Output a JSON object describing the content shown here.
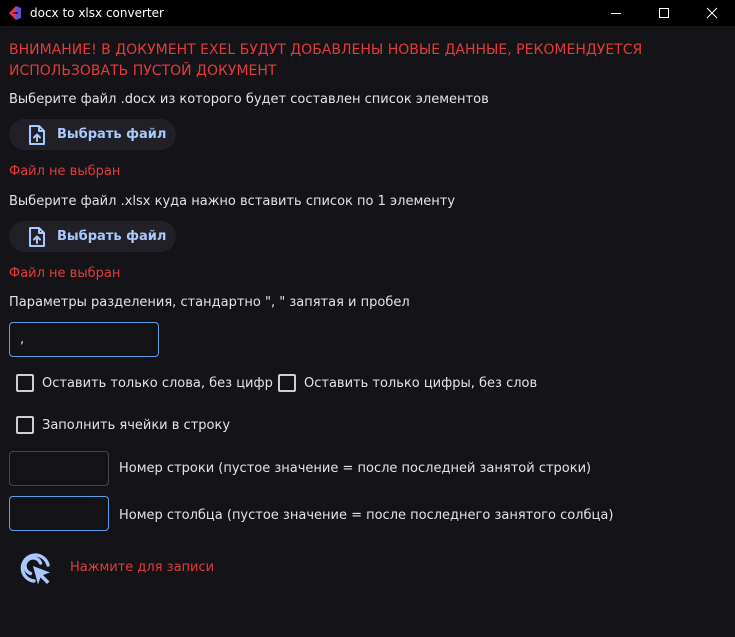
{
  "window": {
    "title": "docx to xlsx converter",
    "icon": "flet-app-icon",
    "controls": {
      "minimize_icon": "minimize-icon",
      "maximize_icon": "maximize-icon",
      "close_icon": "close-icon"
    }
  },
  "warning": "ВНИМАНИЕ! В ДОКУМЕНТ EXEL БУДУТ ДОБАВЛЕНЫ НОВЫЕ ДАННЫЕ, РЕКОМЕНДУЕТСЯ ИСПОЛЬЗОВАТЬ ПУСТОЙ ДОКУМЕНТ",
  "docx_section": {
    "label": "Выберите файл .docx из которого будет составлен список элементов",
    "button_label": "Выбрать файл",
    "button_icon": "file-upload-icon",
    "status": "Файл не выбран"
  },
  "xlsx_section": {
    "label": "Выберите файл .xlsx куда нажно вставить список по 1 элементу",
    "button_label": "Выбрать файл",
    "button_icon": "file-upload-icon",
    "status": "Файл не выбран"
  },
  "separator": {
    "label": "Параметры разделения, стандартно \", \" запятая и пробел",
    "value": ", "
  },
  "options": {
    "words_only": {
      "label": "Оставить только слова, без цифр",
      "checked": false
    },
    "digits_only": {
      "label": "Оставить только цифры, без слов",
      "checked": false
    },
    "fill_row": {
      "label": "Заполнить ячейки в строку",
      "checked": false
    }
  },
  "row_number": {
    "value": "",
    "label": "Номер строки (пустое значение = после последней занятой строки)"
  },
  "column_number": {
    "value": "",
    "label": "Номер столбца (пустое значение = после последнего занятого солбца)"
  },
  "record": {
    "icon": "ads-click-icon",
    "label": "Нажмите для записи"
  },
  "colors": {
    "background": "#141318",
    "warning": "#e33b3b",
    "accent": "#a9c8fb",
    "button_background": "#212026",
    "focus_border": "#5b9fe8"
  }
}
